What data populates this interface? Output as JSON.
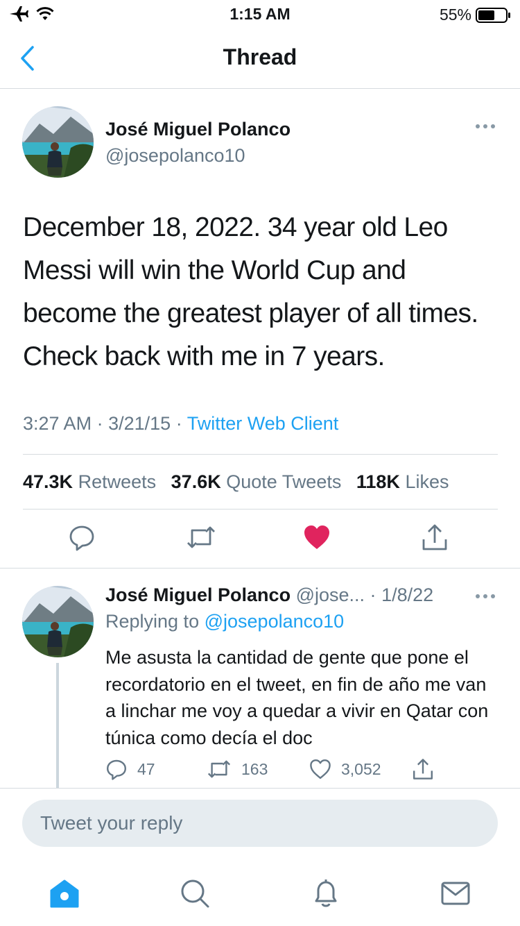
{
  "status_bar": {
    "time": "1:15 AM",
    "battery": "55%",
    "icons": [
      "airplane-icon",
      "wifi-icon",
      "battery-icon"
    ]
  },
  "nav": {
    "title": "Thread",
    "back_icon": "chevron-left-icon"
  },
  "main_tweet": {
    "author_name": "José Miguel Polanco",
    "author_handle": "@josepolanco10",
    "text": "December 18, 2022. 34 year old Leo Messi will win the World Cup and become the greatest player of all times. Check back with me in 7 years.",
    "time": "3:27 AM",
    "date": "3/21/15",
    "client": "Twitter Web Client",
    "separator": "·",
    "stats": {
      "retweets_count": "47.3K",
      "retweets_label": "Retweets",
      "quotes_count": "37.6K",
      "quotes_label": "Quote Tweets",
      "likes_count": "118K",
      "likes_label": "Likes"
    },
    "liked": true
  },
  "reply": {
    "author_name": "José Miguel Polanco",
    "author_handle": "@jose...",
    "date": "1/8/22",
    "separator": "·",
    "replying_prefix": "Replying to",
    "replying_handle": "@josepolanco10",
    "text": "Me asusta la cantidad de gente que pone el recordatorio en el tweet, en fin de año me van a linchar me voy a quedar a vivir en Qatar con túnica como decía el doc",
    "reply_count": "47",
    "retweet_count": "163",
    "like_count": "3,052"
  },
  "composer": {
    "placeholder": "Tweet your reply"
  },
  "tabbar": {
    "items": [
      "home-icon",
      "search-icon",
      "notifications-icon",
      "messages-icon"
    ]
  },
  "colors": {
    "accent": "#1da1f2",
    "like": "#e0245e",
    "secondary_text": "#657786",
    "divider": "#d6dbdf"
  }
}
